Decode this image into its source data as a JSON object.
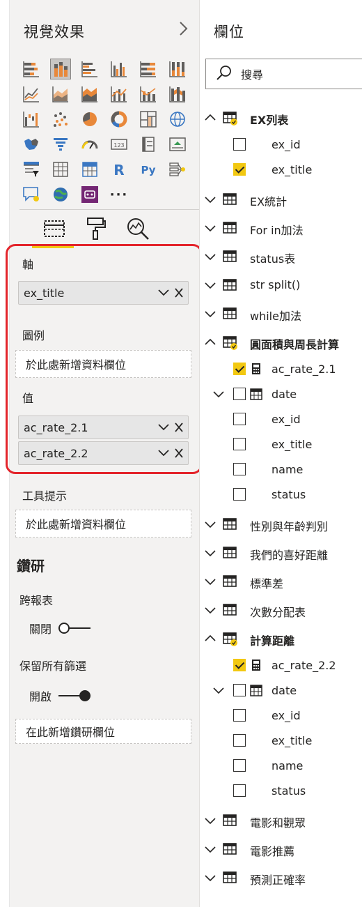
{
  "viz_pane": {
    "title": "視覺效果",
    "expand_icon": "chevron-right-icon",
    "more_label": "···",
    "visual_icons": [
      "stacked-bar-chart-icon",
      "stacked-column-chart-icon",
      "clustered-bar-chart-icon",
      "clustered-column-chart-icon",
      "100-stacked-bar-chart-icon",
      "100-stacked-column-chart-icon",
      "line-chart-icon",
      "area-chart-icon",
      "stacked-area-chart-icon",
      "line-clustered-column-icon",
      "line-stacked-column-icon",
      "ribbon-chart-icon",
      "waterfall-chart-icon",
      "scatter-chart-icon",
      "pie-chart-icon",
      "donut-chart-icon",
      "treemap-icon",
      "map-icon",
      "filled-map-icon",
      "funnel-icon",
      "gauge-icon",
      "card-icon",
      "multi-row-card-icon",
      "kpi-icon",
      "slicer-icon",
      "table-icon",
      "matrix-icon",
      "r-visual-icon",
      "python-visual-icon",
      "key-influencers-icon",
      "qa-visual-icon",
      "arcgis-map-icon",
      "power-apps-icon"
    ],
    "tabs": [
      "fields-tab-icon",
      "format-paintbrush-icon",
      "analytics-magnifier-icon"
    ],
    "wells": {
      "axis_label": "軸",
      "axis_value": "ex_title",
      "legend_label": "圖例",
      "legend_placeholder": "於此處新增資料欄位",
      "values_label": "值",
      "values": [
        "ac_rate_2.1",
        "ac_rate_2.2"
      ],
      "tooltip_label": "工具提示",
      "tooltip_placeholder": "於此處新增資料欄位"
    },
    "drillthrough": {
      "title": "鑽研",
      "cross_report_label": "跨報表",
      "cross_report_state": "關閉",
      "keep_filters_label": "保留所有篩選",
      "keep_filters_state": "開啟",
      "drop_placeholder": "在此新增鑽研欄位"
    },
    "colors": {
      "accent": "#f2c811",
      "highlight_border": "#e3242b"
    }
  },
  "fields_pane": {
    "title": "欄位",
    "search_placeholder": "搜尋",
    "tables": [
      {
        "name": "EX列表",
        "expanded": true,
        "bold": true,
        "active": true,
        "fields": [
          {
            "name": "ex_id",
            "checked": false
          },
          {
            "name": "ex_title",
            "checked": true
          }
        ]
      },
      {
        "name": "EX統計",
        "expanded": false
      },
      {
        "name": "For in加法",
        "expanded": false
      },
      {
        "name": "status表",
        "expanded": false
      },
      {
        "name": "str split()",
        "expanded": false
      },
      {
        "name": "while加法",
        "expanded": false
      },
      {
        "name": "圓面積與周長計算",
        "expanded": true,
        "bold": true,
        "active": true,
        "fields": [
          {
            "name": "ac_rate_2.1",
            "checked": true,
            "measure": true
          },
          {
            "name": "date",
            "checked": false,
            "hierarchy": true
          },
          {
            "name": "ex_id",
            "checked": false
          },
          {
            "name": "ex_title",
            "checked": false
          },
          {
            "name": "name",
            "checked": false
          },
          {
            "name": "status",
            "checked": false
          }
        ]
      },
      {
        "name": "性別與年齡判別",
        "expanded": false
      },
      {
        "name": "我們的喜好距離",
        "expanded": false
      },
      {
        "name": "標準差",
        "expanded": false
      },
      {
        "name": "次數分配表",
        "expanded": false
      },
      {
        "name": "計算距離",
        "expanded": true,
        "bold": true,
        "active": true,
        "fields": [
          {
            "name": "ac_rate_2.2",
            "checked": true,
            "measure": true
          },
          {
            "name": "date",
            "checked": false,
            "hierarchy": true
          },
          {
            "name": "ex_id",
            "checked": false
          },
          {
            "name": "ex_title",
            "checked": false
          },
          {
            "name": "name",
            "checked": false
          },
          {
            "name": "status",
            "checked": false
          }
        ]
      },
      {
        "name": "電影和觀眾",
        "expanded": false
      },
      {
        "name": "電影推薦",
        "expanded": false
      },
      {
        "name": "預測正確率",
        "expanded": false
      }
    ]
  }
}
